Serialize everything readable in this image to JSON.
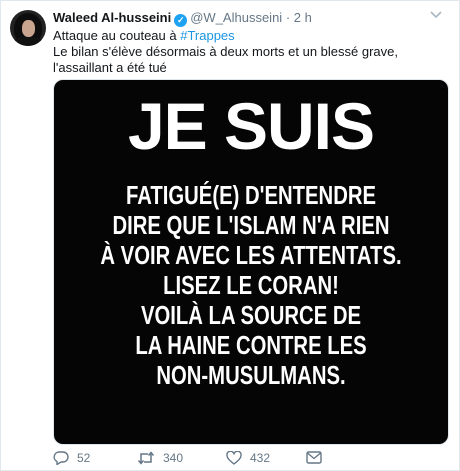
{
  "tweet": {
    "author_name": "Waleed Al-husseini",
    "handle": "@W_Alhusseini",
    "separator": "·",
    "time": "2 h",
    "text_line1_prefix": "Attaque au couteau à ",
    "hashtag": "#Trappes",
    "text_line2": "Le bilan s'élève désormais à deux morts et un blessé grave, l'assaillant a été tué"
  },
  "media": {
    "headline": "JE SUIS",
    "body_lines": [
      "FATIGUÉ(E) D'ENTENDRE",
      "DIRE QUE L'ISLAM N'A RIEN",
      "À VOIR AVEC LES ATTENTATS.",
      "LISEZ LE CORAN!",
      "VOILÀ LA SOURCE DE",
      "LA HAINE CONTRE LES",
      "NON-MUSULMANS."
    ]
  },
  "actions": {
    "reply_count": "52",
    "retweet_count": "340",
    "like_count": "432"
  },
  "icons": {
    "verified": "verified-badge-icon",
    "caret": "chevron-down-icon",
    "reply": "reply-icon",
    "retweet": "retweet-icon",
    "like": "heart-icon",
    "dm": "mail-icon"
  },
  "colors": {
    "link": "#1b95e0",
    "verified": "#1da1f2",
    "meta": "#657786"
  }
}
